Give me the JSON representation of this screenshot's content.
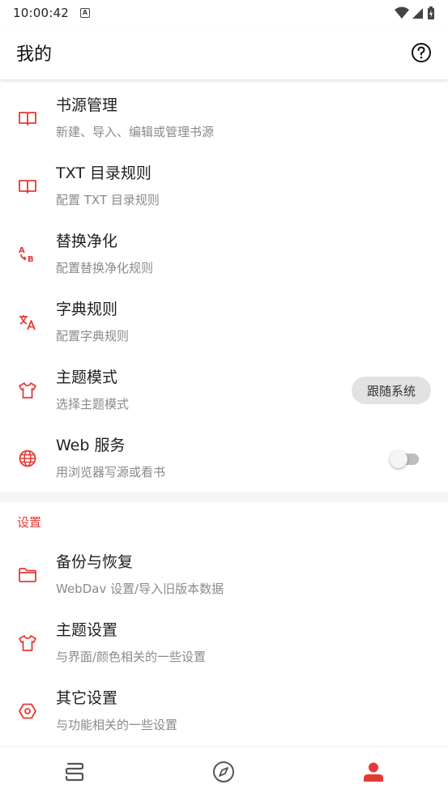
{
  "status_bar": {
    "time": "10:00:42",
    "notification_glyph": "A"
  },
  "app_bar": {
    "title": "我的",
    "help_icon": "help-circle-icon"
  },
  "accent_color": "#e53935",
  "items_top": [
    {
      "title": "书源管理",
      "subtitle": "新建、导入、编辑或管理书源",
      "icon": "book-open-icon"
    },
    {
      "title": "TXT 目录规则",
      "subtitle": "配置 TXT 目录规则",
      "icon": "book-open-icon"
    },
    {
      "title": "替换净化",
      "subtitle": "配置替换净化规则",
      "icon": "replace-ab-icon"
    },
    {
      "title": "字典规则",
      "subtitle": "配置字典规则",
      "icon": "translate-icon"
    },
    {
      "title": "主题模式",
      "subtitle": "选择主题模式",
      "icon": "tshirt-icon",
      "value": "跟随系统"
    },
    {
      "title": "Web 服务",
      "subtitle": "用浏览器写源或看书",
      "icon": "globe-icon",
      "enabled": false
    }
  ],
  "settings_section": {
    "title": "设置",
    "items": [
      {
        "title": "备份与恢复",
        "subtitle": "WebDav 设置/导入旧版本数据",
        "icon": "folder-icon"
      },
      {
        "title": "主题设置",
        "subtitle": "与界面/颜色相关的一些设置",
        "icon": "tshirt-icon"
      },
      {
        "title": "其它设置",
        "subtitle": "与功能相关的一些设置",
        "icon": "hexagon-settings-icon"
      }
    ]
  },
  "bottom_nav": [
    {
      "name": "bookshelf",
      "icon": "bookshelf-icon",
      "active": false
    },
    {
      "name": "explore",
      "icon": "compass-icon",
      "active": false
    },
    {
      "name": "my",
      "icon": "person-icon",
      "active": true
    }
  ]
}
